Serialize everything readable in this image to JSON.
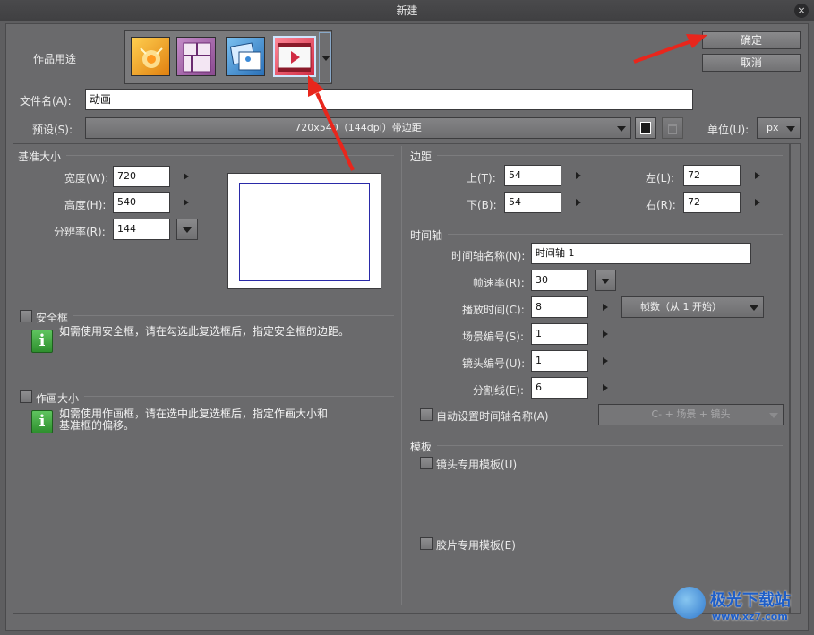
{
  "window": {
    "title": "新建",
    "close": "×"
  },
  "work_usage": {
    "label": "作品用途",
    "icons": [
      {
        "name": "illustration-icon",
        "color": "#f0a020"
      },
      {
        "name": "comic-icon",
        "color": "#9a5aa0"
      },
      {
        "name": "photo-icon",
        "color": "#3a86c8"
      },
      {
        "name": "animation-icon",
        "color": "#e0485a"
      }
    ]
  },
  "buttons": {
    "ok": "确定",
    "cancel": "取消"
  },
  "filename": {
    "label": "文件名(A):",
    "value": "动画"
  },
  "preset": {
    "label": "预设(S):",
    "value": "720x540（144dpi）带边距"
  },
  "unit": {
    "label": "单位(U):",
    "value": "px"
  },
  "base_size": {
    "title": "基准大小",
    "width_label": "宽度(W):",
    "width": "720",
    "height_label": "高度(H):",
    "height": "540",
    "resolution_label": "分辨率(R):",
    "resolution": "144"
  },
  "safe_frame": {
    "label": "安全框",
    "note": "如需使用安全框，请在勾选此复选框后，指定安全框的边距。"
  },
  "draw_size": {
    "label": "作画大小",
    "note_line1": "如需使用作画框，请在选中此复选框后，指定作画大小和",
    "note_line2": "基准框的偏移。"
  },
  "margin": {
    "title": "边距",
    "top_label": "上(T):",
    "top": "54",
    "bottom_label": "下(B):",
    "bottom": "54",
    "left_label": "左(L):",
    "left": "72",
    "right_label": "右(R):",
    "right": "72"
  },
  "timeline": {
    "title": "时间轴",
    "name_label": "时间轴名称(N):",
    "name": "时间轴 1",
    "fps_label": "帧速率(R):",
    "fps": "30",
    "duration_label": "播放时间(C):",
    "duration": "8",
    "duration_mode": "帧数（从 1 开始）",
    "scene_label": "场景编号(S):",
    "scene": "1",
    "cut_label": "镜头编号(U):",
    "cut": "1",
    "split_label": "分割线(E):",
    "split": "6",
    "auto_name_label": "自动设置时间轴名称(A)",
    "auto_name_format": "C- + 场景 + 镜头"
  },
  "template": {
    "title": "模板",
    "cut_template": "镜头专用模板(U)",
    "film_template": "胶片专用模板(E)"
  },
  "watermark": {
    "text": "极光下载站",
    "url": "www.xz7.com"
  },
  "colors": {
    "accent_arrow": "#e8261c",
    "preview_border": "#2a2aa8"
  }
}
